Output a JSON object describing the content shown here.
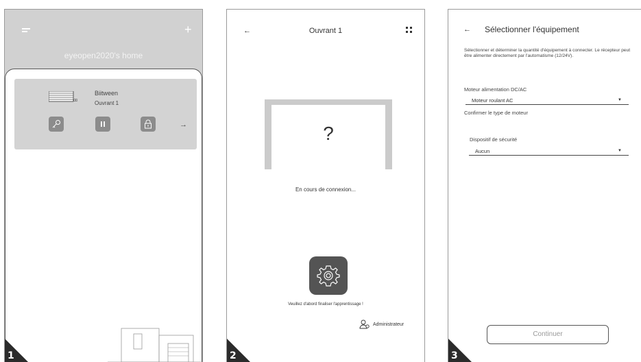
{
  "panel1": {
    "home_title": "eyeopen2020's home",
    "device": {
      "name": "Biitween",
      "subtitle": "Ouvrant 1"
    },
    "card_arrow": "→",
    "step": "1"
  },
  "panel2": {
    "title": "Ouvrant 1",
    "back": "←",
    "placeholder_mark": "?",
    "status": "En cours de connexion...",
    "warning": "Veuillez d'abord finaliser l'apprentissage !",
    "admin_label": "Administrateur",
    "step": "2"
  },
  "panel3": {
    "back": "←",
    "title": "Sélectionner l'équipement",
    "description": "Sélectionner et déterminer la quantité d'équipement à connecter. Le récepteur peut être alimenter directement par l'automatisme (12/24V).",
    "motor_label": "Moteur alimentation DC/AC",
    "motor_value": "Moteur roulant AC",
    "motor_hint": "Confirmer le type de moteur",
    "safety_label": "Dispositif de sécurité",
    "safety_value": "Aucun",
    "continue_label": "Continuer",
    "step": "3"
  },
  "colors": {
    "header_gray": "#d1d1d1",
    "card_gray": "#d3d3d3",
    "button_gray": "#8c8c8c",
    "gear_button": "#545454",
    "step_badge": "#2b2b2b"
  }
}
